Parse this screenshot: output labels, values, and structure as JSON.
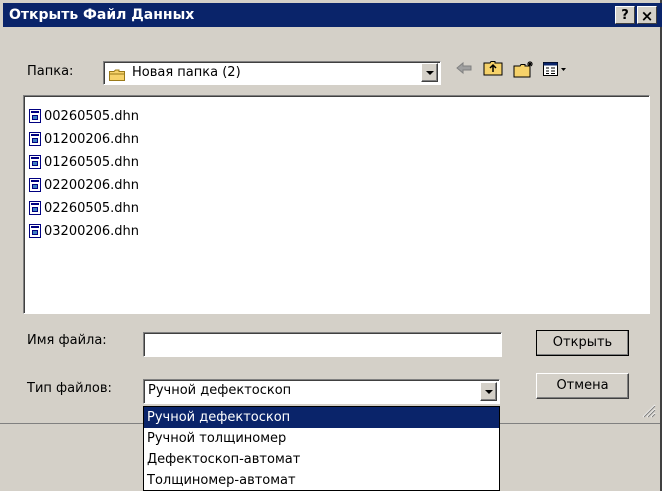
{
  "dialog": {
    "title": "Открыть Файл Данных",
    "help_label": "?",
    "close_label": "×"
  },
  "folder": {
    "label": "Папка:",
    "value": "Новая папка (2)"
  },
  "toolbar": {
    "icons": [
      "back-arrow-icon",
      "up-folder-icon",
      "new-folder-icon",
      "view-menu-icon"
    ]
  },
  "files": [
    {
      "name": "00260505.dhn"
    },
    {
      "name": "01200206.dhn"
    },
    {
      "name": "01260505.dhn"
    },
    {
      "name": "02200206.dhn"
    },
    {
      "name": "02260505.dhn"
    },
    {
      "name": "03200206.dhn"
    }
  ],
  "filename": {
    "label": "Имя файла:",
    "value": ""
  },
  "filetype": {
    "label": "Тип файлов:",
    "value": "Ручной дефектоскоп",
    "options": [
      "Ручной дефектоскоп",
      "Ручной толщиномер",
      "Дефектоскоп-автомат",
      "Толщиномер-автомат"
    ],
    "selected_index": 0
  },
  "buttons": {
    "open_label": "Открыть",
    "cancel_label": "Отмена"
  },
  "colors": {
    "titlebar": "#0a246a",
    "face": "#d4d0c8",
    "selection": "#0a246a"
  }
}
